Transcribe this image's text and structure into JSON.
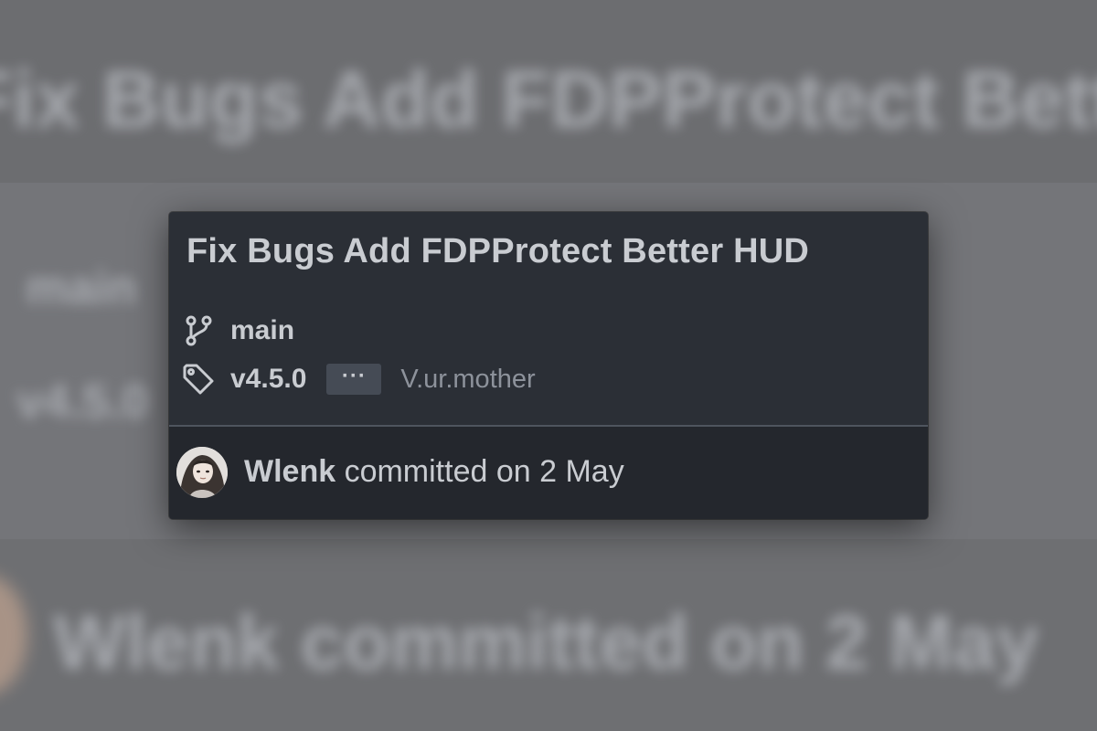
{
  "commit": {
    "title": "Fix Bugs Add FDPProtect Better HUD",
    "branch": "main",
    "tag": "v4.5.0",
    "more_label": "···",
    "other_tag": "V.ur.mother",
    "author": "Wlenk",
    "commit_text": "committed on 2 May"
  },
  "icons": {
    "branch": "git-branch-icon",
    "tag": "tag-icon",
    "avatar": "user-avatar"
  },
  "colors": {
    "card_background": "#2b2f36",
    "footer_background": "#24272d",
    "text_primary": "#c9ccd1",
    "text_muted": "#8d929b",
    "button_background": "#454b55",
    "page_background": "#707174"
  }
}
